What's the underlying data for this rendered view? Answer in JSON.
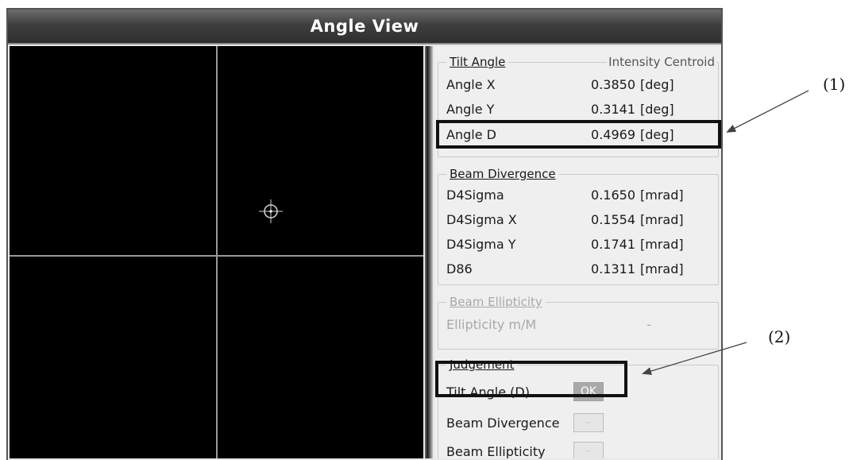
{
  "window": {
    "title": "Angle View"
  },
  "tilt_angle": {
    "legend": "Tilt Angle",
    "mode": "Intensity Centroid",
    "rows": [
      {
        "label": "Angle X",
        "value": "0.3850",
        "unit": "[deg]"
      },
      {
        "label": "Angle Y",
        "value": "0.3141",
        "unit": "[deg]"
      },
      {
        "label": "Angle D",
        "value": "0.4969",
        "unit": "[deg]"
      }
    ]
  },
  "beam_divergence": {
    "legend": "Beam Divergence",
    "rows": [
      {
        "label": "D4Sigma",
        "value": "0.1650",
        "unit": "[mrad]"
      },
      {
        "label": "D4Sigma X",
        "value": "0.1554",
        "unit": "[mrad]"
      },
      {
        "label": "D4Sigma Y",
        "value": "0.1741",
        "unit": "[mrad]"
      },
      {
        "label": "D86",
        "value": "0.1311",
        "unit": "[mrad]"
      }
    ]
  },
  "beam_ellipticity": {
    "legend": "Beam Ellipticity",
    "rows": [
      {
        "label": "Ellipticity m/M",
        "value": "-"
      }
    ]
  },
  "judgement": {
    "legend": "Judgement",
    "rows": [
      {
        "label": "Tilt Angle (D)",
        "result": "OK"
      },
      {
        "label": "Beam Divergence",
        "result": "-"
      },
      {
        "label": "Beam Ellipticity",
        "result": "-"
      }
    ]
  },
  "callouts": {
    "one": "(1)",
    "two": "(2)"
  },
  "colors": {
    "ok_badge": "#a9a9a9",
    "title_bar": "#3f3f3f",
    "viewport": "#000000"
  }
}
